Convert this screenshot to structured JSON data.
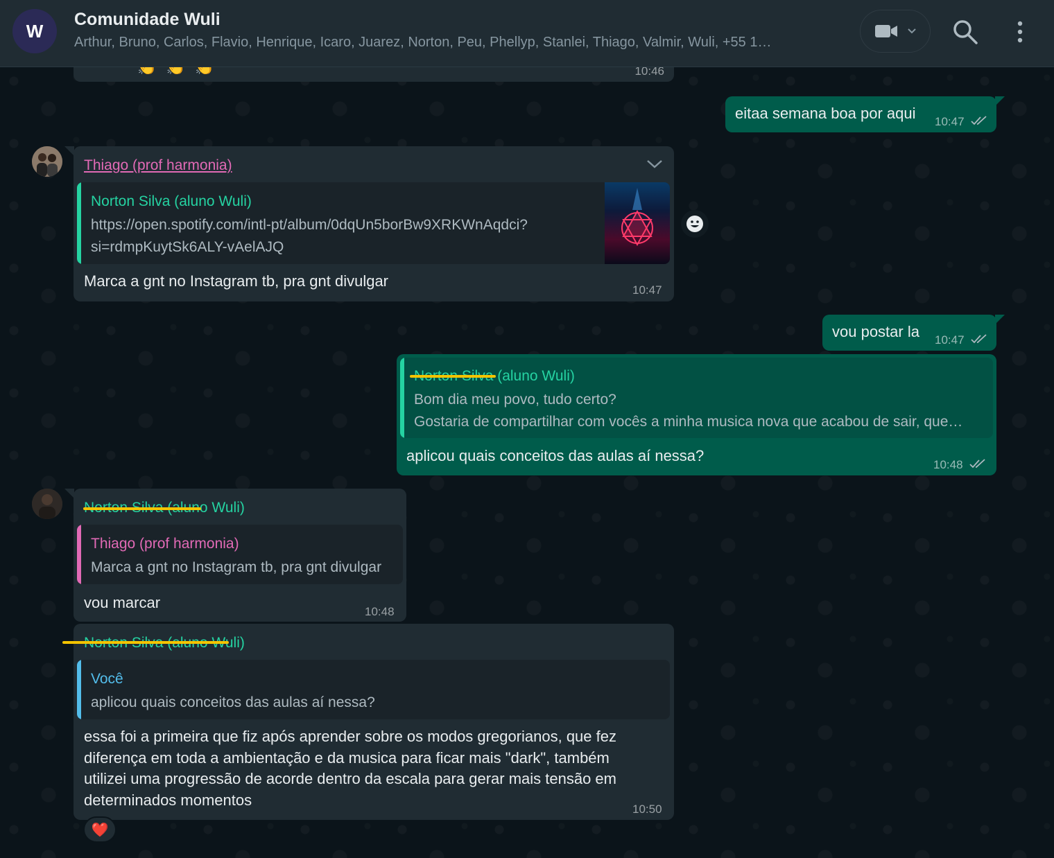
{
  "header": {
    "avatar_letter": "W",
    "title": "Comunidade Wuli",
    "members": "Arthur, Bruno, Carlos, Flavio, Henrique, Icaro, Juarez, Norton, Peu, Phellyp, Stanlei, Thiago, Valmir, Wuli, +55 1…"
  },
  "messages": {
    "m0": {
      "time": "10:46",
      "emojis": "👏 👏 👏"
    },
    "m1": {
      "text": "eitaa semana boa por aqui",
      "time": "10:47"
    },
    "m2": {
      "sender": "Thiago (prof harmonia)",
      "quote_author": "Norton Silva (aluno Wuli)",
      "quote_line1": "https://open.spotify.com/intl-pt/album/0dqUn5borBw9XRKWnAqdci?",
      "quote_line2": "si=rdmpKuytSk6ALY-vAelAJQ",
      "text": "Marca a gnt no Instagram tb, pra gnt divulgar",
      "time": "10:47"
    },
    "m3": {
      "text": "vou postar la",
      "time": "10:47"
    },
    "m4": {
      "quote_author": "Norton Silva (aluno Wuli)",
      "quote_line1": "Bom dia meu povo, tudo certo?",
      "quote_line2": "Gostaria de compartilhar com vocês a minha musica nova que acabou de sair, que…",
      "text": "aplicou quais conceitos das aulas aí nessa?",
      "time": "10:48"
    },
    "m5": {
      "sender": "Norton Silva (aluno Wuli)",
      "quote_author": "Thiago (prof harmonia)",
      "quote_line1": "Marca a gnt no Instagram tb, pra gnt divulgar",
      "text": "vou marcar",
      "time": "10:48"
    },
    "m6": {
      "sender": "Norton Silva (aluno Wuli)",
      "quote_author": "Você",
      "quote_line1": "aplicou quais conceitos das aulas aí nessa?",
      "line1": "essa foi a primeira que fiz após aprender sobre os modos gregorianos, que fez",
      "line2": "diferença em toda a ambientação e da musica para ficar mais \"dark\", também",
      "line3": "utilizei uma progressão de acorde dentro da escala para gerar mais tensão em",
      "line4": "determinados momentos",
      "time": "10:50",
      "reaction": "❤️"
    }
  },
  "colors": {
    "header_bg": "#202c33",
    "chat_bg": "#0b141a",
    "incoming_bubble": "#202c33",
    "outgoing_bubble": "#005c4b",
    "name_pink": "#e26ab6",
    "name_green": "#25d3a2",
    "name_blue": "#53bdeb",
    "strike_yellow": "#f3c300"
  }
}
